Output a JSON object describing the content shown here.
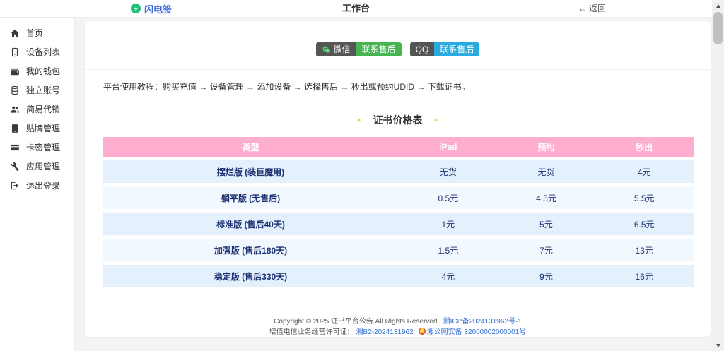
{
  "header": {
    "logo_text": "闪电签",
    "title": "工作台",
    "back_label": "返回"
  },
  "sidebar": {
    "items": [
      {
        "id": "home",
        "icon": "home",
        "label": "首页"
      },
      {
        "id": "device-list",
        "icon": "smartphone",
        "label": "设备列表"
      },
      {
        "id": "my-wallet",
        "icon": "wallet",
        "label": "我的钱包"
      },
      {
        "id": "independent-account",
        "icon": "coins",
        "label": "独立账号"
      },
      {
        "id": "easy-resale",
        "icon": "users",
        "label": "简易代销"
      },
      {
        "id": "oem-management",
        "icon": "tablet",
        "label": "贴牌管理"
      },
      {
        "id": "card-key-management",
        "icon": "credit-card",
        "label": "卡密管理"
      },
      {
        "id": "app-management",
        "icon": "wrench",
        "label": "应用管理"
      },
      {
        "id": "logout",
        "icon": "sign-out",
        "label": "退出登录"
      }
    ]
  },
  "contact": {
    "wechat_left": "微信",
    "wechat_right": "联系售后",
    "qq_left": "QQ",
    "qq_right": "联系售后"
  },
  "tutorial": "平台使用教程：购买充值 → 设备管理 → 添加设备 → 选择售后 → 秒出或预约UDID → 下载证书。",
  "price_table": {
    "title": "证书价格表",
    "columns": [
      "类型",
      "iPad",
      "预约",
      "秒出"
    ],
    "rows": [
      [
        "摆烂版 (装巨魔用)",
        "无货",
        "无货",
        "4元"
      ],
      [
        "躺平版 (无售后)",
        "0.5元",
        "4.5元",
        "5.5元"
      ],
      [
        "标准版 (售后40天)",
        "1元",
        "5元",
        "6.5元"
      ],
      [
        "加强版 (售后180天)",
        "1.5元",
        "7元",
        "13元"
      ],
      [
        "稳定版 (售后330天)",
        "4元",
        "9元",
        "16元"
      ]
    ]
  },
  "footer": {
    "line1_text": "Copyright © 2025 证书平台公告 All Rights Reserved | ",
    "line1_link": "湘ICP备2024131962号-1",
    "line2_text": "增值电信业务经营许可证： ",
    "line2_link1": "湘B2-2024131962",
    "line2_link2": "湘公网安备 32000002000001号"
  },
  "colors": {
    "accent_blue": "#3f6ae0",
    "logo_green": "#1fbf7a",
    "badge_dark": "#555555",
    "wechat_green": "#46b450",
    "qq_blue": "#29abe2",
    "table_header_pink": "#ffaed0",
    "row_light": "#e4f1fc",
    "row_lighter": "#f1f8fe",
    "row_text": "#1d3172",
    "sparkle_yellow": "#f0c13a",
    "link_blue": "#3370d4"
  }
}
